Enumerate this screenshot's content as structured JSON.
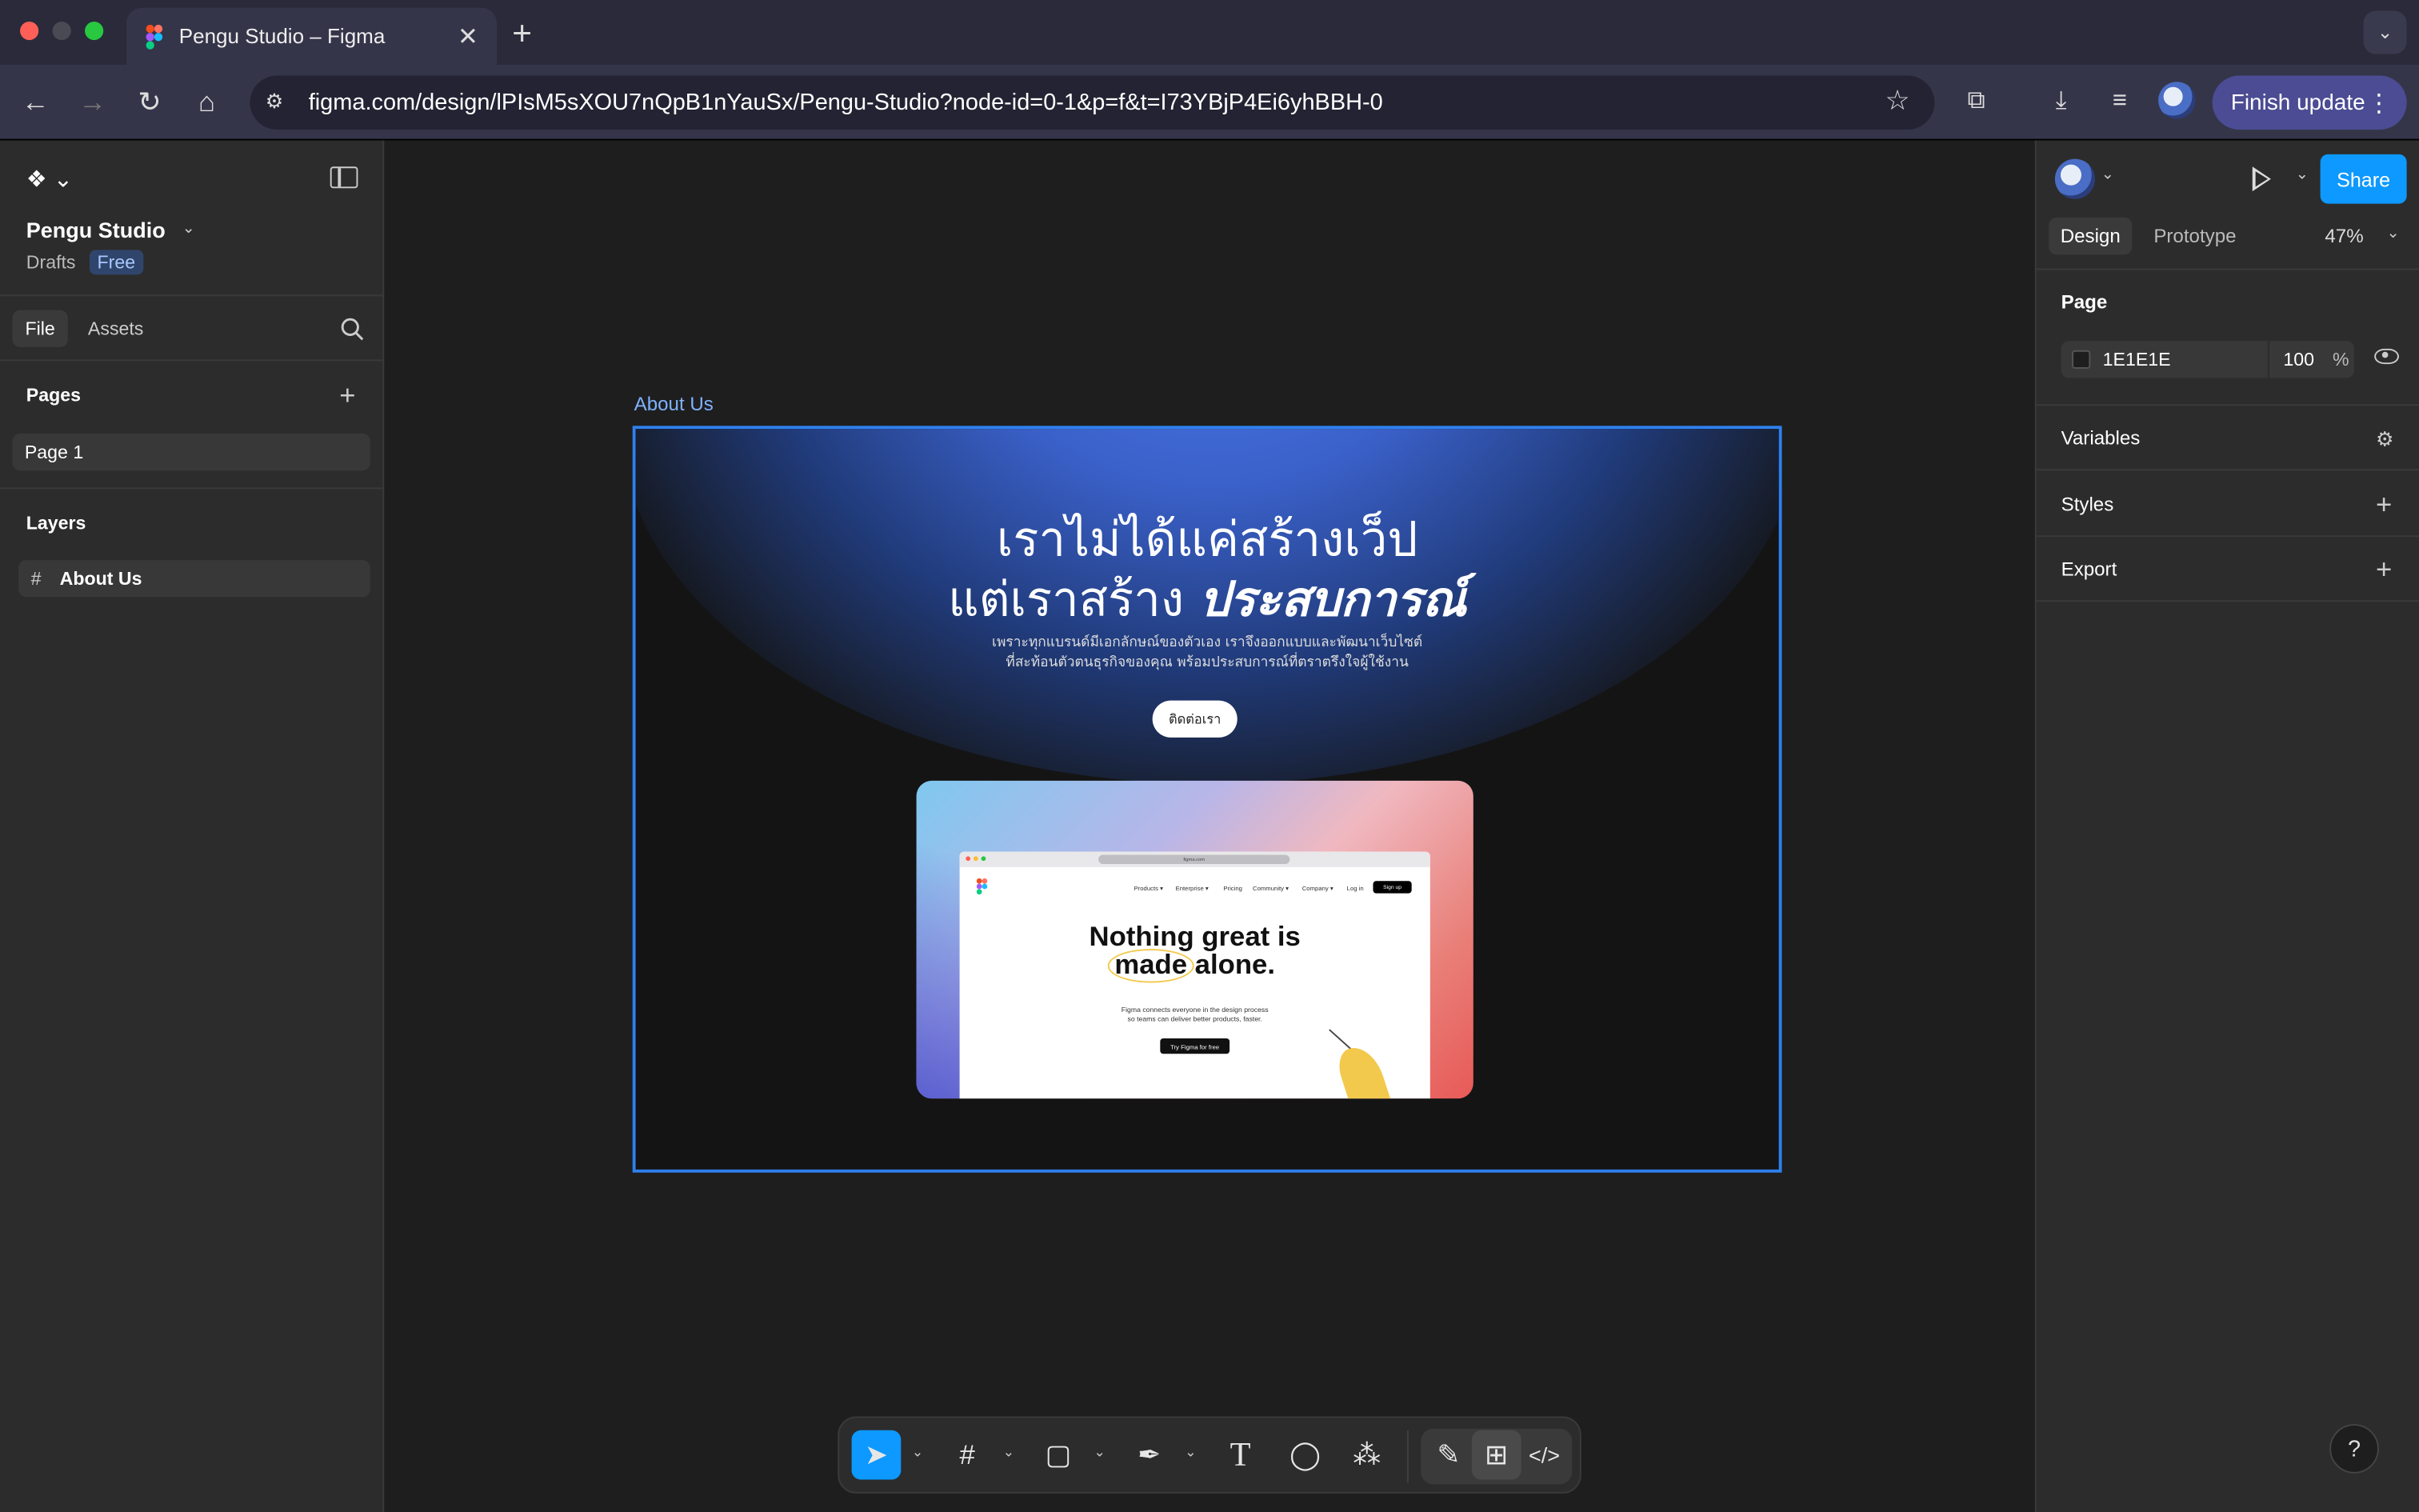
{
  "browser": {
    "tab_title": "Pengu Studio – Figma",
    "url": "figma.com/design/lPIsM5sXOU7nQpB1nYauSx/Pengu-Studio?node-id=0-1&p=f&t=I73YBjP4Ei6yhBBH-0",
    "finish_update_label": "Finish update"
  },
  "left_panel": {
    "project_name": "Pengu Studio",
    "drafts_label": "Drafts",
    "plan_badge": "Free",
    "tabs": [
      "File",
      "Assets"
    ],
    "pages_title": "Pages",
    "pages": [
      "Page 1"
    ],
    "layers_title": "Layers",
    "layers": [
      "About Us"
    ]
  },
  "right_panel": {
    "share_label": "Share",
    "tabs": [
      "Design",
      "Prototype"
    ],
    "zoom": "47%",
    "page_title": "Page",
    "page_fill_hex": "1E1E1E",
    "page_fill_opacity": "100",
    "page_fill_unit": "%",
    "variables_title": "Variables",
    "styles_title": "Styles",
    "export_title": "Export",
    "help_label": "?"
  },
  "canvas": {
    "frame_label": "About Us",
    "hero_line1": "เราไม่ได้แค่สร้างเว็ป",
    "hero_line2_prefix": "แต่เราสร้าง ",
    "hero_line2_emphasis": "ประสบการณ์",
    "hero_sub_line1": "เพราะทุกแบรนด์มีเอกลักษณ์ของตัวเอง เราจึงออกแบบและพัฒนาเว็บไซต์",
    "hero_sub_line2": "ที่สะท้อนตัวตนธุรกิจของคุณ พร้อมประสบการณ์ที่ตราตรึงใจผู้ใช้งาน",
    "hero_button": "ติดต่อเรา",
    "mock": {
      "url": "figma.com",
      "nav": [
        "Products ▾",
        "Enterprise ▾",
        "Pricing",
        "Community ▾",
        "Company ▾",
        "Log in"
      ],
      "signup": "Sign up",
      "headline_line1": "Nothing great is",
      "headline_line2": "made alone.",
      "sub_line1": "Figma connects everyone in the design process",
      "sub_line2": "so teams can deliver better products, faster.",
      "cta": "Try Figma for free"
    }
  },
  "colors": {
    "accent": "#0d99ff",
    "frame_selection": "#2f80ed",
    "canvas_bg": "#1e1e1e",
    "panel_bg": "#2c2c2c"
  }
}
